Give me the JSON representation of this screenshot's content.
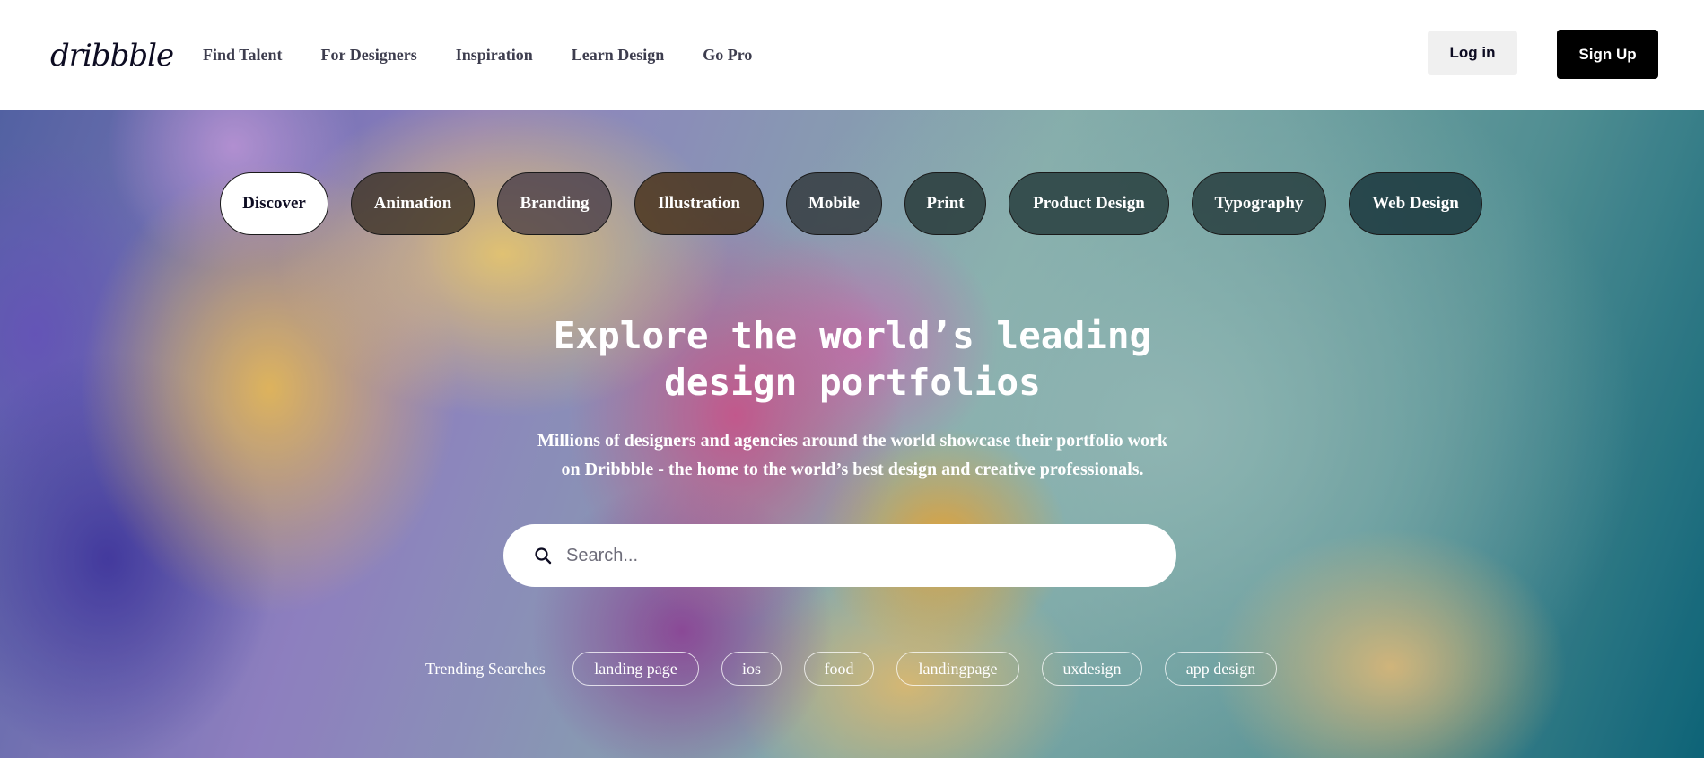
{
  "header": {
    "logo_text": "dribbble",
    "nav": [
      "Find Talent",
      "For Designers",
      "Inspiration",
      "Learn Design",
      "Go Pro"
    ],
    "login_label": "Log in",
    "signup_label": "Sign Up"
  },
  "hero": {
    "categories": [
      "Discover",
      "Animation",
      "Branding",
      "Illustration",
      "Mobile",
      "Print",
      "Product Design",
      "Typography",
      "Web Design"
    ],
    "active_category": "Discover",
    "title": "Explore the world’s leading\ndesign portfolios",
    "subtitle": "Millions of designers and agencies around the world showcase their portfolio work\non Dribbble - the home to the world’s best design and creative professionals.",
    "search": {
      "placeholder": "Search...",
      "value": ""
    },
    "trending_label": "Trending Searches",
    "trending": [
      "landing page",
      "ios",
      "food",
      "landingpage",
      "uxdesign",
      "app design"
    ]
  },
  "colors": {
    "brand_dark": "#0d0c22",
    "signup_bg": "#000000",
    "login_bg": "#f0f0f0",
    "pill_dark": "#282828"
  },
  "icons": {
    "search": "search-icon",
    "logo": "dribbble-logo"
  }
}
